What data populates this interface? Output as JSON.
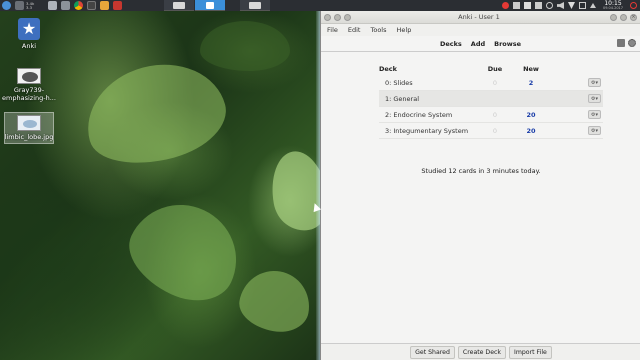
{
  "taskbar": {
    "cpu_top": "3.4k",
    "cpu_bottom": "3.3",
    "clock_time": "10:15",
    "clock_date": "09.04.2017"
  },
  "desktop": {
    "icons": [
      {
        "label": "Anki"
      },
      {
        "label": "Gray739-emphasizing-h..."
      },
      {
        "label": "limbic_lobe.jpg"
      }
    ]
  },
  "window": {
    "title": "Anki - User 1",
    "menu": [
      "File",
      "Edit",
      "Tools",
      "Help"
    ],
    "toolbar": [
      "Decks",
      "Add",
      "Browse"
    ],
    "deck_headers": {
      "deck": "Deck",
      "due": "Due",
      "new": "New"
    },
    "decks": [
      {
        "name": "0: Slides",
        "due": "0",
        "new": "2"
      },
      {
        "name": "1: General",
        "due": "",
        "new": ""
      },
      {
        "name": "2: Endocrine System",
        "due": "0",
        "new": "20"
      },
      {
        "name": "3: Integumentary System",
        "due": "0",
        "new": "20"
      }
    ],
    "studied": "Studied 12 cards in 3 minutes today.",
    "bottom_buttons": [
      "Get Shared",
      "Create Deck",
      "Import File"
    ]
  },
  "colors": {
    "accent": "#3b8fd9",
    "new_count": "#1a3da8"
  }
}
